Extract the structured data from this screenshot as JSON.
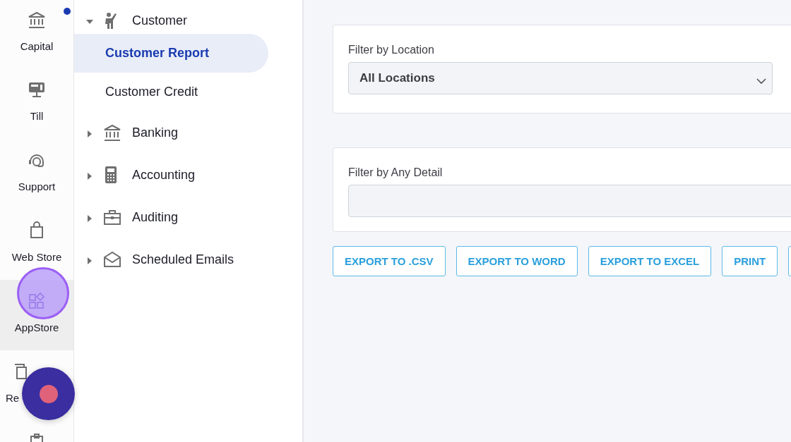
{
  "rail": {
    "items": [
      {
        "label": "Capital",
        "selected": false,
        "badge": true
      },
      {
        "label": "Till",
        "selected": false,
        "badge": false
      },
      {
        "label": "Support",
        "selected": false,
        "badge": false
      },
      {
        "label": "Web Store",
        "selected": false,
        "badge": false
      },
      {
        "label": "AppStore",
        "selected": true,
        "badge": false
      },
      {
        "label": "Re",
        "selected": false,
        "badge": false
      },
      {
        "selected": false,
        "badge": false
      }
    ]
  },
  "nav": {
    "items": [
      {
        "label": "Customer",
        "expanded": true,
        "children": [
          {
            "label": "Customer Report",
            "selected": true
          },
          {
            "label": "Customer Credit",
            "selected": false
          }
        ]
      },
      {
        "label": "Banking",
        "expanded": false
      },
      {
        "label": "Accounting",
        "expanded": false
      },
      {
        "label": "Auditing",
        "expanded": false
      },
      {
        "label": "Scheduled Emails",
        "expanded": false
      }
    ]
  },
  "filters": [
    {
      "kind": "select",
      "label": "Filter by Location",
      "value": "All Locations"
    },
    {
      "kind": "text",
      "label": "Filter by Any Detail"
    }
  ],
  "buttons": [
    "EXPORT TO .CSV",
    "EXPORT TO WORD",
    "EXPORT TO EXCEL",
    "PRINT"
  ]
}
